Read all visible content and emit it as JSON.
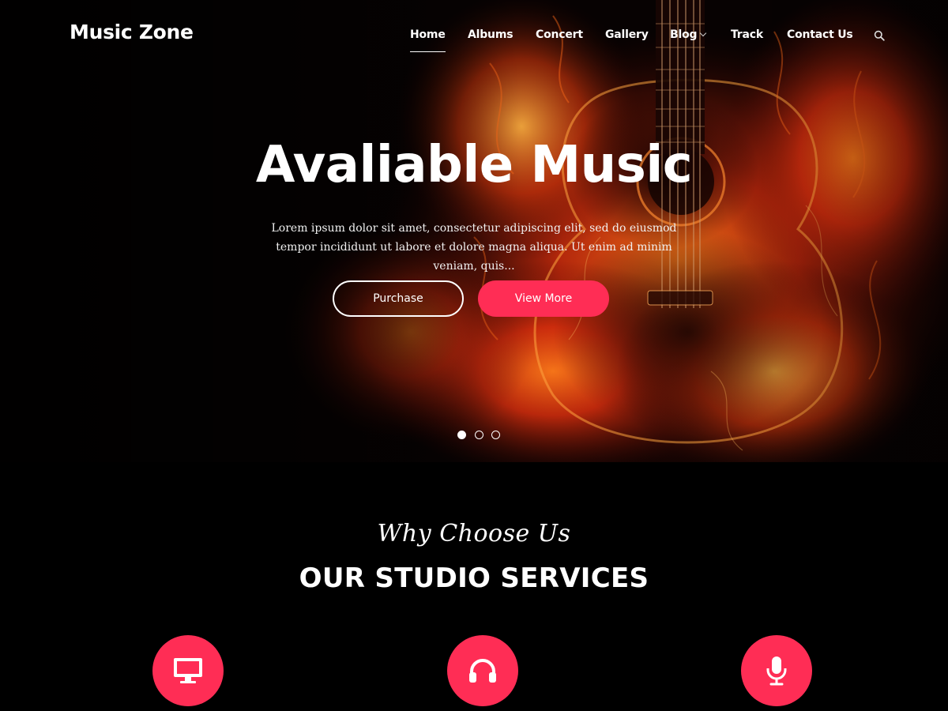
{
  "header": {
    "brand": "Music Zone",
    "nav": [
      {
        "label": "Home",
        "active": true
      },
      {
        "label": "Albums"
      },
      {
        "label": "Concert"
      },
      {
        "label": "Gallery"
      },
      {
        "label": "Blog",
        "has_dropdown": true
      },
      {
        "label": "Track"
      },
      {
        "label": "Contact Us"
      }
    ],
    "search_icon": "search-icon"
  },
  "hero": {
    "title": "Avaliable Music",
    "description": "Lorem ipsum dolor sit amet, consectetur adipiscing elit, sed do eiusmod tempor incididunt ut labore et dolore magna aliqua. Ut enim ad minim veniam, quis...",
    "buttons": {
      "primary": "Purchase",
      "secondary": "View More"
    },
    "slides_total": 3,
    "slide_active": 1
  },
  "services": {
    "eyebrow": "Why Choose Us",
    "title": "OUR STUDIO SERVICES",
    "icons": [
      "monitor-icon",
      "headphones-icon",
      "microphone-icon"
    ]
  },
  "colors": {
    "accent": "#ff2d55",
    "background": "#000000",
    "text": "#ffffff"
  }
}
